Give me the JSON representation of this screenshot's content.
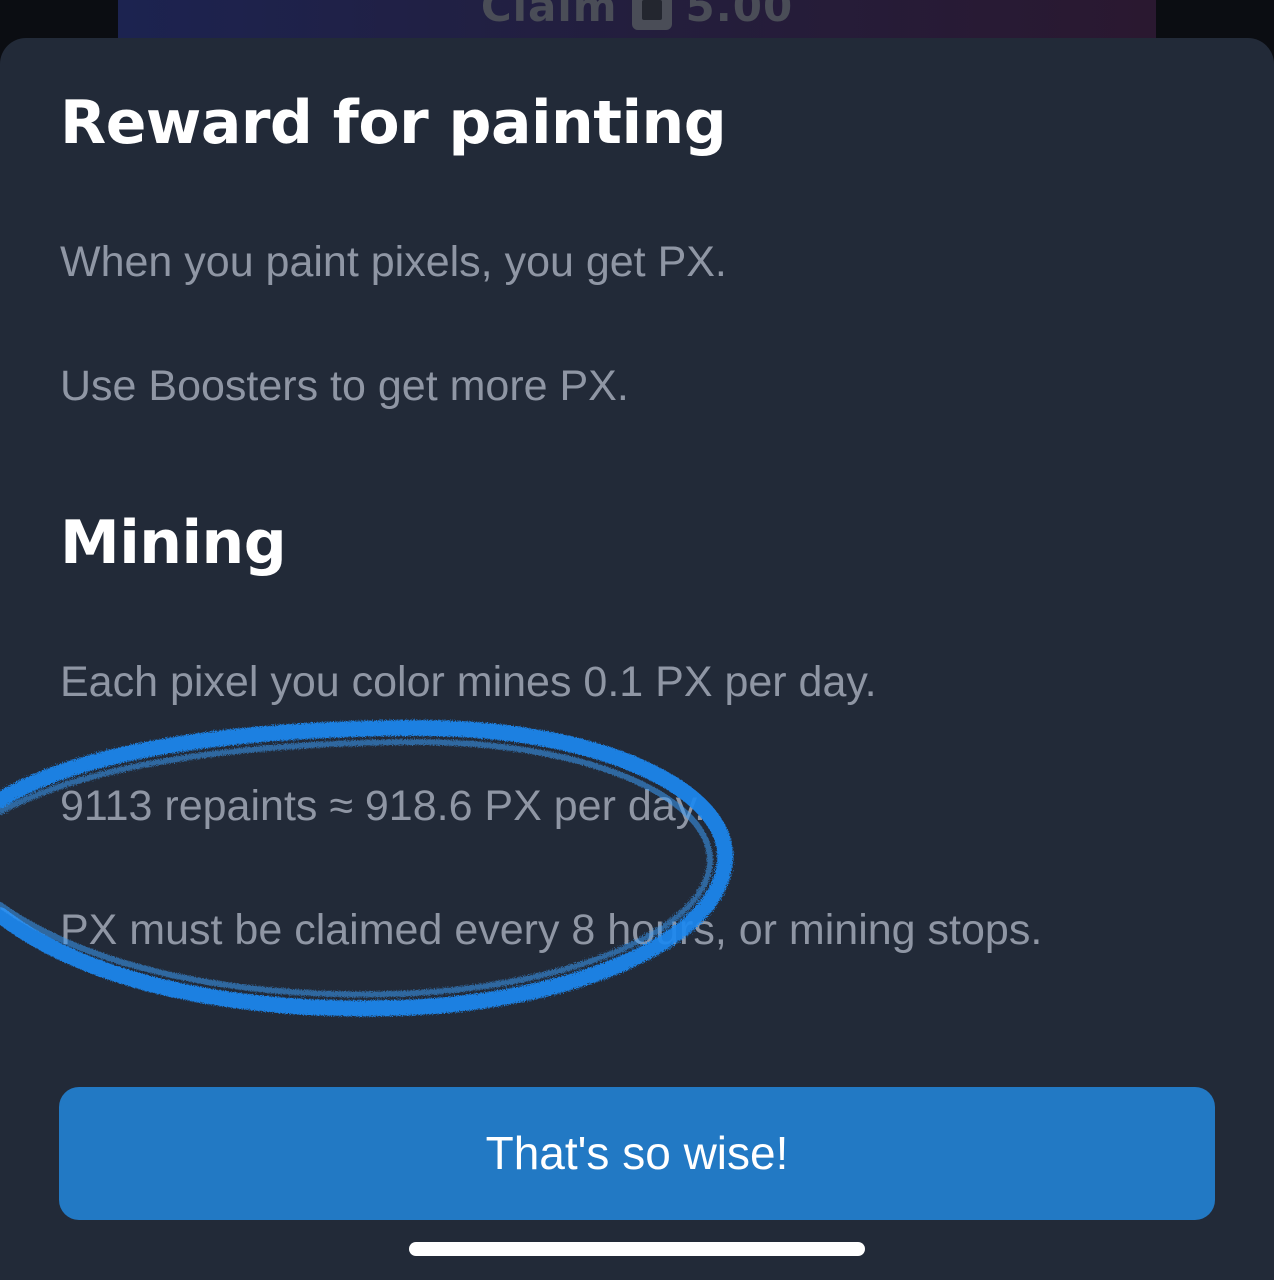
{
  "background": {
    "claim_label": "Claim",
    "claim_amount": "5.00",
    "claim_icon": "coin-icon"
  },
  "sheet": {
    "reward_title": "Reward for painting",
    "reward_text_1": "When you paint pixels, you get PX.",
    "reward_text_2": "Use Boosters to get more PX.",
    "mining_title": "Mining",
    "mining_text_1": "Each pixel you color mines 0.1 PX per day.",
    "mining_text_2": "9113 repaints ≈ 918.6 PX per day.",
    "mining_text_3": "PX must be claimed every 8 hours, or mining stops.",
    "confirm_button": "That's so wise!"
  },
  "colors": {
    "sheet_bg": "#222a38",
    "title": "#ffffff",
    "body_text": "#8f96a4",
    "button": "#2279c4",
    "annotation_ink": "#1e88f0"
  }
}
